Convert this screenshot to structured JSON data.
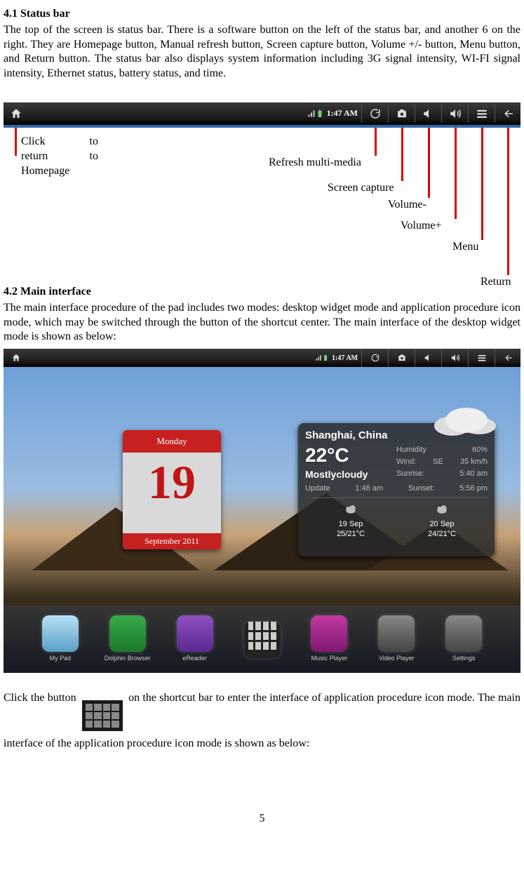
{
  "sections": {
    "s41": {
      "heading": "4.1 Status bar",
      "body": "The top of the screen is status bar. There is a software button on the left of the status bar, and another 6 on the right. They are Homepage button, Manual refresh button, Screen capture button, Volume +/- button, Menu button, and Return button. The status bar also displays system information including 3G signal intensity, WI-FI signal intensity, Ethernet status, battery status, and time."
    },
    "s42": {
      "heading": "4.2 Main interface",
      "body1": "The main interface procedure of the pad includes two modes: desktop widget mode and application procedure icon mode, which may be switched through the button of the shortcut center. The main interface of the desktop widget mode is shown as below:",
      "body2a": "Click the button",
      "body2b": "on the shortcut bar to enter the interface of application procedure icon mode. The main interface of the application procedure icon mode is shown as below:"
    }
  },
  "statusbar": {
    "time": "1:47 AM",
    "icons": {
      "home": "home-icon",
      "signal": "signal-icon",
      "battery": "battery-icon",
      "refresh": "refresh-icon",
      "camera": "camera-icon",
      "volminus": "volume-minus-icon",
      "volplus": "volume-plus-icon",
      "menu": "menu-icon",
      "return": "return-icon"
    }
  },
  "callouts": {
    "home_l1a": "Click",
    "home_l1b": "to",
    "home_l2a": "return",
    "home_l2b": "to",
    "home_l3": "Homepage",
    "refresh": "Refresh multi-media",
    "screencap": "Screen capture",
    "volminus": "Volume-",
    "volplus": "Volume+",
    "menu": "Menu",
    "return": "Return"
  },
  "desktop": {
    "statusbar_time": "1:47 AM",
    "calendar": {
      "weekday": "Monday",
      "day": "19",
      "month_year": "September  2011"
    },
    "weather": {
      "city": "Shanghai, China",
      "temp": "22°C",
      "cond": "Mostlycloudy",
      "humidity_label": "Humidity",
      "humidity": "60%",
      "wind_label": "Wind:",
      "wind_dir": "SE",
      "wind_spd": "35 km/h",
      "sunrise_label": "Sunrise:",
      "sunrise": "5:40 am",
      "update_label": "Update",
      "update_time": "1:46 am",
      "sunset_label": "Sunset:",
      "sunset": "5:56 pm",
      "fc1_date": "19 Sep",
      "fc1_temps": "25/21°C",
      "fc2_date": "20 Sep",
      "fc2_temps": "24/21°C"
    },
    "dock": [
      {
        "label": "My Pad",
        "bg": "linear-gradient(#b8e0f5,#5aa0c8)"
      },
      {
        "label": "Dolphin Browser",
        "bg": "linear-gradient(#3aa84a,#1a7a2a)"
      },
      {
        "label": "eReader",
        "bg": "linear-gradient(#9050c0,#5a2890)"
      },
      {
        "label": "",
        "bg": "#222",
        "grid": true
      },
      {
        "label": "Music Player",
        "bg": "linear-gradient(#c03aa0,#801870)"
      },
      {
        "label": "Video Player",
        "bg": "linear-gradient(#888,#444)"
      },
      {
        "label": "Settings",
        "bg": "linear-gradient(#888,#444)"
      }
    ]
  },
  "page_number": "5"
}
